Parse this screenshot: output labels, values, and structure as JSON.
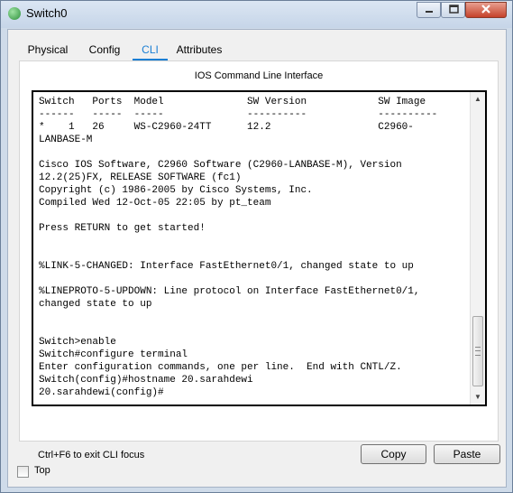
{
  "window": {
    "title": "Switch0",
    "icons": {
      "app": "device-icon",
      "minimize": "minimize-icon",
      "maximize": "maximize-icon",
      "close": "close-icon"
    }
  },
  "tabs": [
    {
      "label": "Physical",
      "active": false
    },
    {
      "label": "Config",
      "active": false
    },
    {
      "label": "CLI",
      "active": true
    },
    {
      "label": "Attributes",
      "active": false
    }
  ],
  "panel": {
    "title": "IOS Command Line Interface"
  },
  "terminal": {
    "lines": [
      "Switch   Ports  Model              SW Version            SW Image",
      "------   -----  -----              ----------            ----------",
      "*    1   26     WS-C2960-24TT      12.2                  C2960-",
      "LANBASE-M",
      "",
      "Cisco IOS Software, C2960 Software (C2960-LANBASE-M), Version",
      "12.2(25)FX, RELEASE SOFTWARE (fc1)",
      "Copyright (c) 1986-2005 by Cisco Systems, Inc.",
      "Compiled Wed 12-Oct-05 22:05 by pt_team",
      "",
      "Press RETURN to get started!",
      "",
      "",
      "%LINK-5-CHANGED: Interface FastEthernet0/1, changed state to up",
      "",
      "%LINEPROTO-5-UPDOWN: Line protocol on Interface FastEthernet0/1,",
      "changed state to up",
      "",
      "",
      "Switch>enable",
      "Switch#configure terminal",
      "Enter configuration commands, one per line.  End with CNTL/Z.",
      "Switch(config)#hostname 20.sarahdewi",
      "20.sarahdewi(config)#"
    ]
  },
  "focus_hint": "Ctrl+F6 to exit CLI focus",
  "buttons": {
    "copy": "Copy",
    "paste": "Paste"
  },
  "footer": {
    "top_label": "Top",
    "top_checked": false
  },
  "colors": {
    "accent": "#1a7fd4",
    "window_frame": "#cfdbe9",
    "close_button": "#c5412a"
  }
}
